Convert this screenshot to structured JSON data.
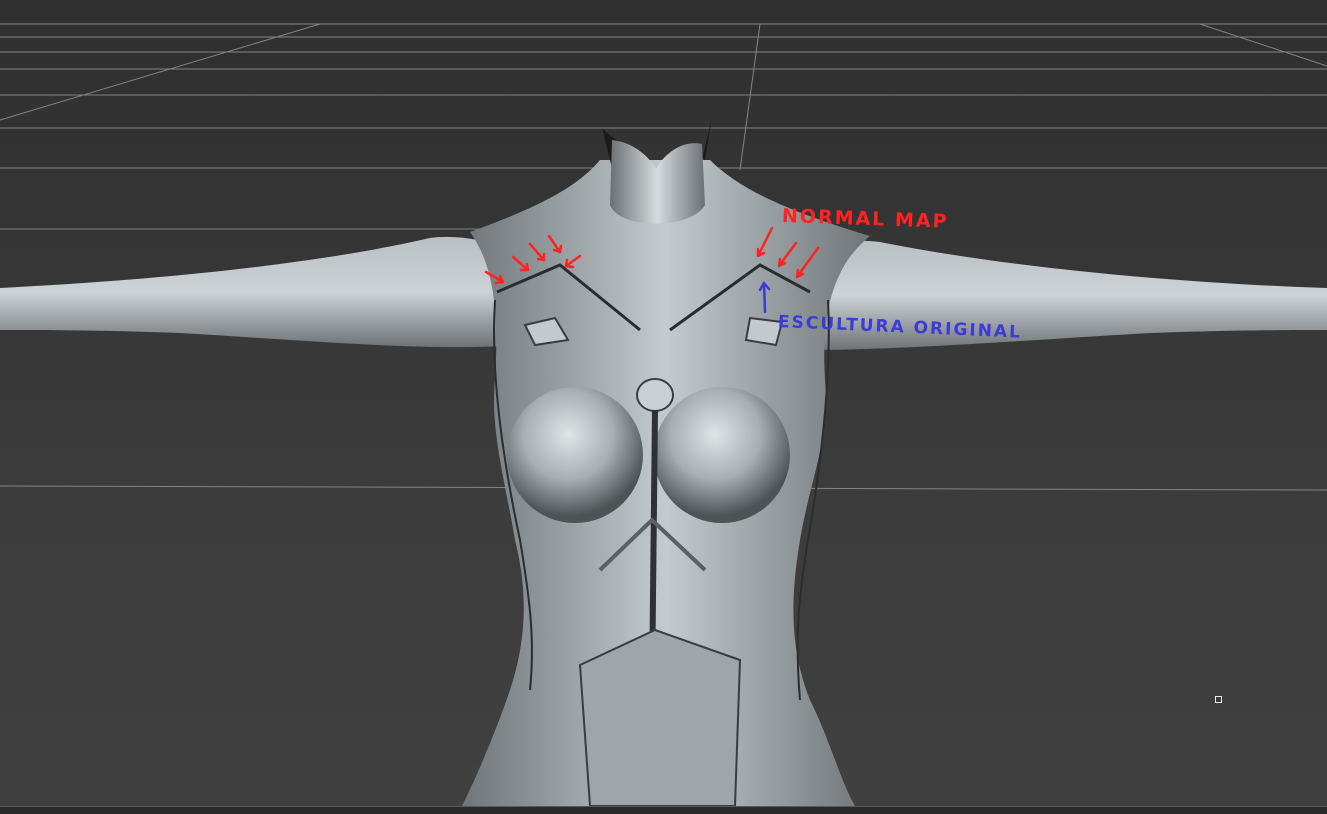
{
  "viewport": {
    "background": "#3b3b3b",
    "grid_color": "#8c8c8c",
    "mesh_color": "#9aa1a4"
  },
  "annotations": {
    "normal_map": {
      "text": "NORMAL MAP",
      "color": "#ff2222"
    },
    "escultura_original": {
      "text": "ESCULTURA ORIGINAL",
      "color": "#3b3bd6"
    }
  },
  "icons": {
    "pivot": "pivot-handle-icon"
  }
}
